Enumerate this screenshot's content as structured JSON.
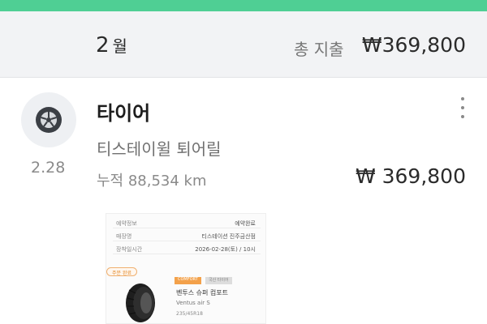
{
  "month_header": {
    "month_number": "2",
    "month_unit": "월",
    "total_label": "총 지출",
    "total_value": "₩369,800"
  },
  "entry": {
    "icon": "tire-icon",
    "date": "2.28",
    "title": "타이어",
    "shop": "티스테이윌 퇴어릴",
    "mileage": "누적 88,534 km",
    "amount": "₩ 369,800",
    "receipt": {
      "rows": [
        {
          "key": "예약정보",
          "value": "예약완료"
        },
        {
          "key": "매장명",
          "value": "티스테이션 진주금산점"
        },
        {
          "key": "장착일시간",
          "value": "2026-02-28(토) / 10시"
        }
      ],
      "badge": "주문 완료",
      "tag_primary": "COMFORT",
      "tag_secondary": "국산 타이어",
      "product_name": "벤투스 슈퍼 컴포트",
      "product_en": "Ventus air S",
      "product_size": "235/45R18"
    }
  },
  "colors": {
    "accent": "#4fcf94",
    "header_bg": "#f2f3f5",
    "receipt_orange": "#e38a2a"
  }
}
